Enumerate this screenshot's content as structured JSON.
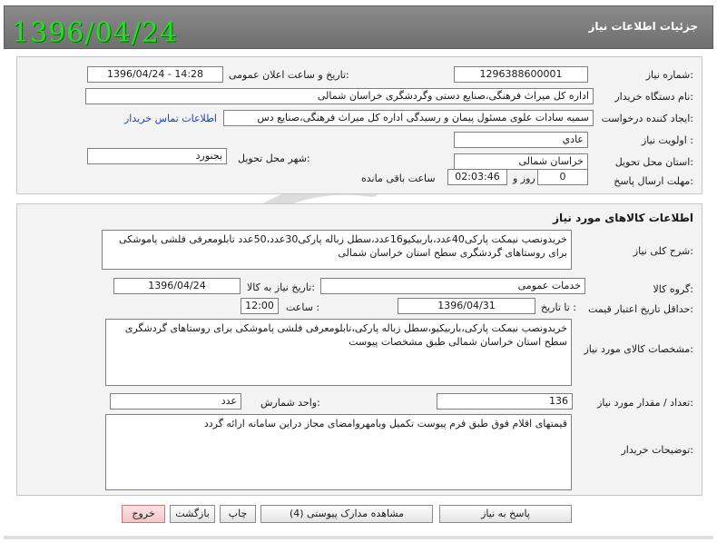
{
  "header": {
    "title": "جزئیات اطلاعات نیاز",
    "date_stamp": "1396/04/24"
  },
  "need_info": {
    "need_number_label": "شماره نیاز:",
    "need_number": "1296388600001",
    "announce_label": "تاریخ و ساعت اعلان عمومی:",
    "announce_value": "1396/04/24 - 14:28",
    "buyer_org_label": "نام دستگاه خریدار:",
    "buyer_org": "اداره کل میراث فرهنگی،صنایع دستی وگردشگری خراسان شمالی",
    "requester_label": "ایجاد کننده درخواست:",
    "requester": "سمیه سادات  علوی مسئول پیمان و رسیدگی اداره کل میراث فرهنگی،صنایع دس",
    "contact_link": "اطلاعات تماس خریدار",
    "priority_label": "اولویت نیاز :",
    "priority": "عادي",
    "province_label": "استان محل تحویل:",
    "province": "خراسان شمالی",
    "city_label": "شهر محل تحویل:",
    "city": "بجنورد",
    "deadline_label": "مهلت ارسال پاسخ:",
    "deadline_days": "0",
    "days_and": "روز و",
    "deadline_time": "02:03:46",
    "remaining_label": "ساعت باقی مانده"
  },
  "goods": {
    "section_title": "اطلاعات کالاهای مورد نیاز",
    "summary_label": "شرح کلی نیاز:",
    "summary": "خریدونصب نیمکت پارکی40عدد،باربیکیو16عدد،سطل زباله پارکی30عدد،50عدد تابلومعرفی فلشی پاموشکی برای روستاهای گردشگری سطح استان خراسان شمالی",
    "group_label": "گروه کالا:",
    "group": "خدمات عمومی",
    "need_date_label": "تاریخ نیاز به کالا:",
    "need_date": "1396/04/24",
    "min_validity_label": "حداقل تاریخ اعتبار قیمت:",
    "until_date_label": "تا تاریخ :",
    "until_date": "1396/04/31",
    "time_label": "ساعت :",
    "time": "12:00",
    "specs_label": "مشخصات کالای مورد نیاز:",
    "specs": "خریدونصب نیمکت پارکی،باربیکیو،سطل زباله پارکی،تابلومعرفی فلشی پاموشکی برای روستاهای گردشگری سطح استان خراسان شمالی طبق مشخصات پیوست",
    "qty_label": "تعداد / مقدار مورد نیاز:",
    "qty": "136",
    "unit_label": "واحد شمارش:",
    "unit": "عدد",
    "buyer_notes_label": "توضیحات خریدار:",
    "buyer_notes": "قیمتهای اقلام فوق طبق فرم پیوست تکمیل وبامهروامضای مجاز دراین سامانه ارائه گردد"
  },
  "actions": {
    "reply": "پاسخ به نیاز",
    "attachments": "مشاهده مدارک پیوستی (4)",
    "print": "چاپ",
    "back": "بازگشت",
    "exit": "خروج"
  },
  "colors": {
    "titlebar": "#7d7d7d",
    "date_stamp": "#1fe11f",
    "link": "#1a3fcf",
    "exit_button": "#f3c6c6"
  }
}
